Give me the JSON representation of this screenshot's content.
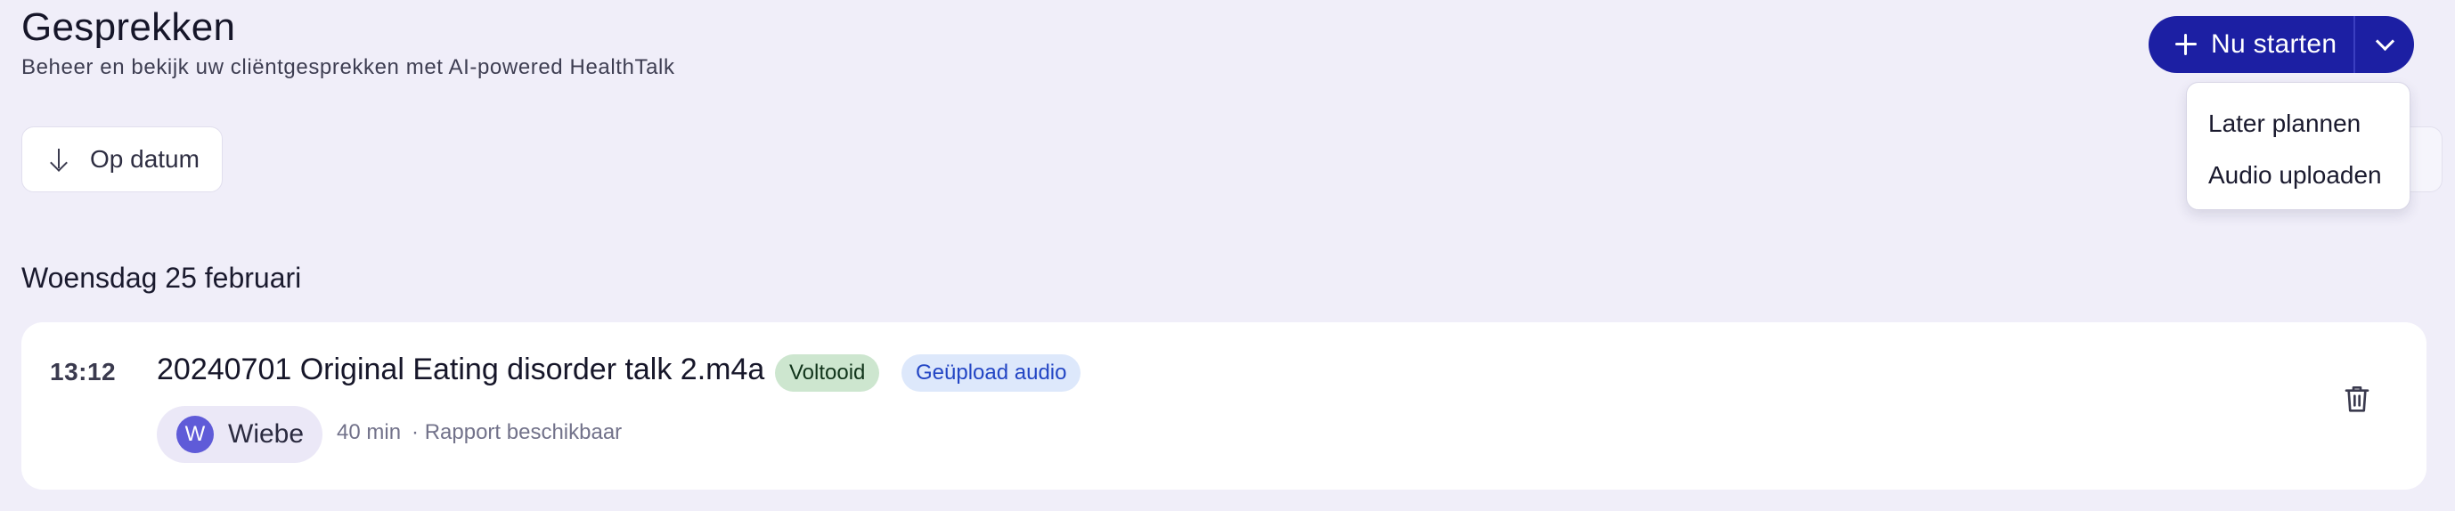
{
  "header": {
    "title": "Gesprekken",
    "subtitle": "Beheer en bekijk uw cliëntgesprekken met AI-powered HealthTalk"
  },
  "start_button": {
    "label": "Nu starten",
    "icon": "plus-icon",
    "caret_icon": "chevron-down-icon"
  },
  "dropdown": {
    "items": [
      {
        "label": "Later plannen"
      },
      {
        "label": "Audio uploaden"
      }
    ]
  },
  "sort": {
    "label": "Op datum",
    "icon": "arrow-down-icon"
  },
  "groups": [
    {
      "date_label": "Woensdag 25 februari",
      "items": [
        {
          "time": "13:12",
          "title": "20240701 Original Eating disorder talk 2.m4a",
          "badges": [
            {
              "label": "Voltooid",
              "color": "#cde6cf"
            },
            {
              "label": "Geüpload audio",
              "color": "#dde8fb"
            }
          ],
          "user": {
            "initial": "W",
            "name": "Wiebe"
          },
          "duration": "40 min",
          "report_status": "· Rapport beschikbaar",
          "delete_icon": "trash-icon"
        }
      ]
    }
  ],
  "colors": {
    "background": "#f0eef9",
    "primary": "#1c1fa3",
    "avatar": "#5f5bd8"
  }
}
